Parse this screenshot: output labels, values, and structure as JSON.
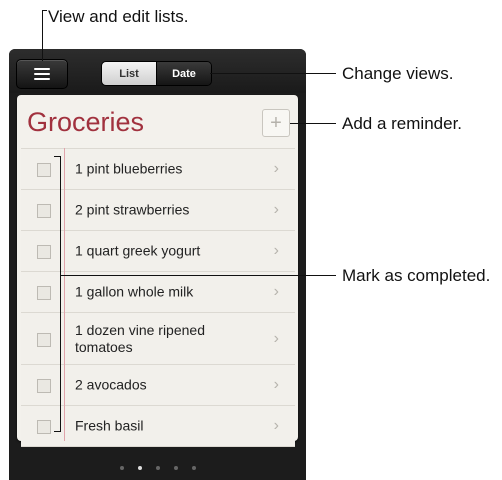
{
  "callouts": {
    "view_edit": "View and edit lists.",
    "change_views": "Change views.",
    "add_reminder": "Add a reminder.",
    "mark_completed": "Mark as completed."
  },
  "toolbar": {
    "menu_icon": "list-menu-icon",
    "segments": [
      "List",
      "Date"
    ],
    "selected_segment": "List"
  },
  "list": {
    "title": "Groceries",
    "add_icon": "plus-icon",
    "title_color": "#a1313e",
    "items": [
      {
        "label": "1 pint blueberries"
      },
      {
        "label": "2 pint strawberries"
      },
      {
        "label": "1 quart greek yogurt"
      },
      {
        "label": "1 gallon whole milk"
      },
      {
        "label": "1 dozen vine ripened tomatoes"
      },
      {
        "label": "2 avocados"
      },
      {
        "label": "Fresh basil"
      }
    ]
  },
  "page_indicator": {
    "count": 5,
    "active_index": 1
  }
}
